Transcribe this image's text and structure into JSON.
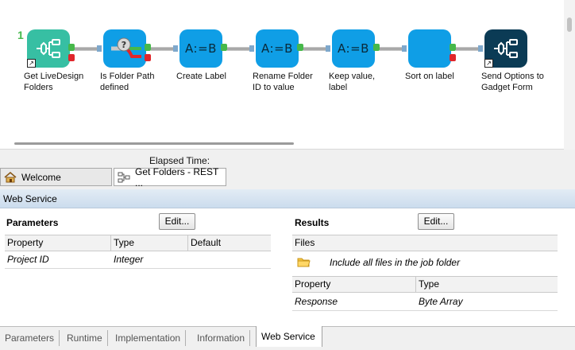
{
  "canvas": {
    "step_number": "1",
    "nodes": [
      {
        "label": "Get LiveDesign\nFolders",
        "kind": "teal",
        "icon": "tree-icon"
      },
      {
        "label": "Is Folder Path\ndefined",
        "kind": "blue",
        "icon": "branch-question-icon"
      },
      {
        "label": "Create Label",
        "kind": "blue",
        "text": "A:=B"
      },
      {
        "label": "Rename Folder\nID to value",
        "kind": "blue",
        "text": "A:=B"
      },
      {
        "label": "Keep value,\nlabel",
        "kind": "blue",
        "text": "A:=B"
      },
      {
        "label": "Sort on label",
        "kind": "blue"
      },
      {
        "label": "Send Options to\nGadget Form",
        "kind": "dark",
        "icon": "tree-icon"
      }
    ],
    "elapsed_label": "Elapsed Time:"
  },
  "doc_tabs": [
    {
      "label": "Welcome",
      "icon": "home-icon"
    },
    {
      "label": "Get Folders - REST ...",
      "icon": "flow-icon"
    }
  ],
  "web_service": {
    "title": "Web Service",
    "parameters": {
      "title": "Parameters",
      "edit_label": "Edit...",
      "columns": [
        "Property",
        "Type",
        "Default"
      ],
      "rows": [
        {
          "property": "Project ID",
          "type": "Integer",
          "default": ""
        }
      ]
    },
    "results": {
      "title": "Results",
      "edit_label": "Edit...",
      "files_header": "Files",
      "files_item": "Include all files in the job folder",
      "columns": [
        "Property",
        "Type"
      ],
      "rows": [
        {
          "property": "Response",
          "type": "Byte Array"
        }
      ]
    }
  },
  "bottom_tabs": [
    "Parameters",
    "Runtime",
    "Implementation",
    "Information",
    "Web Service"
  ],
  "active_bottom_tab": "Web Service",
  "colors": {
    "teal": "#37bfa3",
    "blue": "#0f9ee6",
    "dark": "#0b3b55",
    "green_port": "#47b84a",
    "red_port": "#e0262b"
  }
}
